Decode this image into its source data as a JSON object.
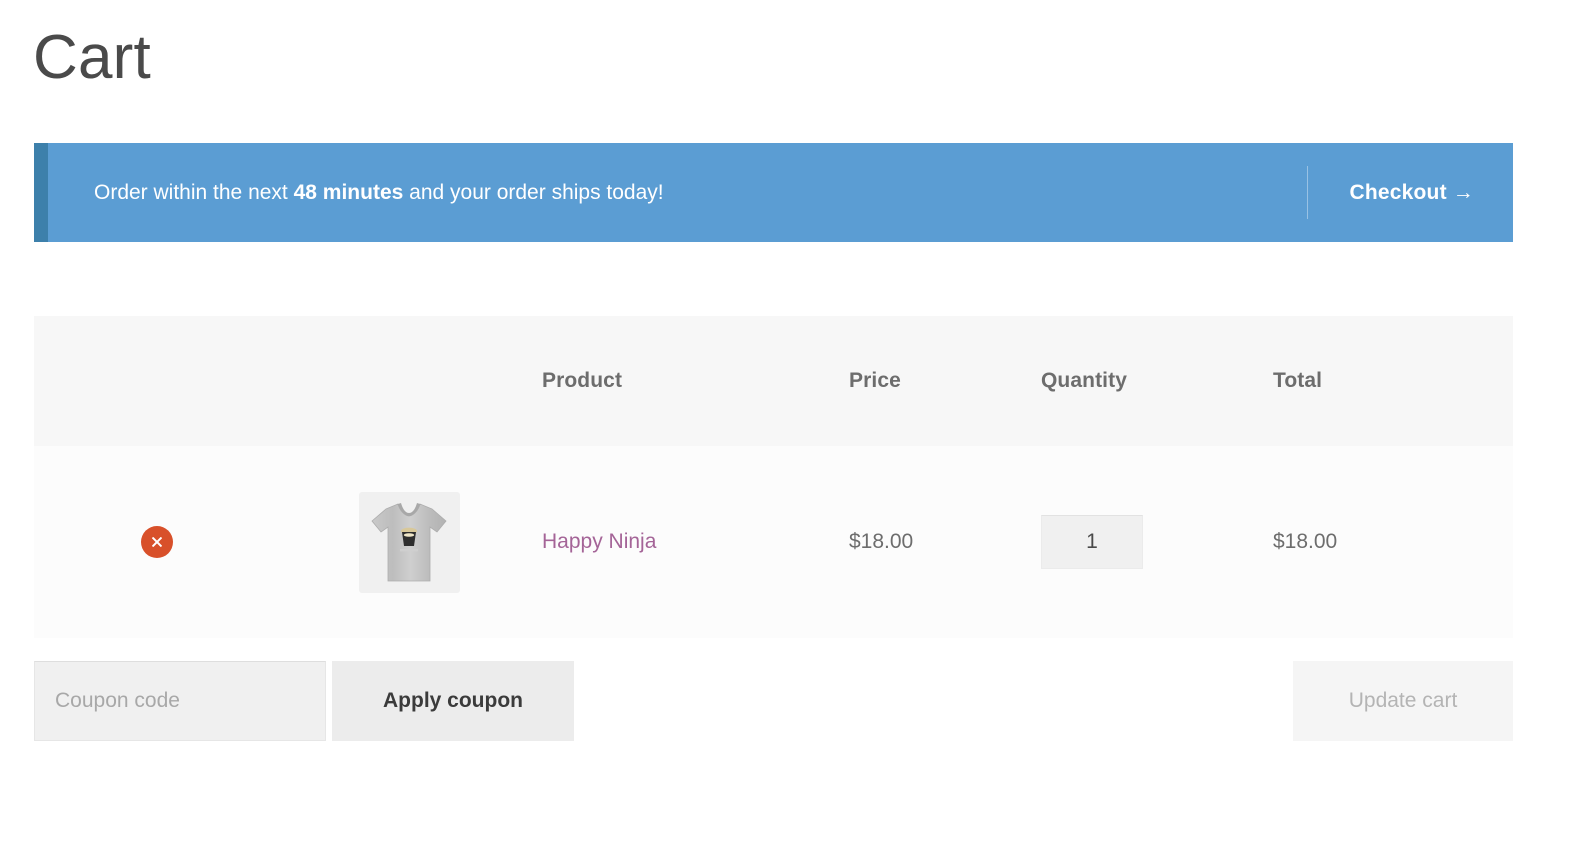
{
  "page": {
    "title": "Cart"
  },
  "banner": {
    "text_before": "Order within the next ",
    "highlight": "48 minutes",
    "text_after": " and your order ships today!",
    "checkout_label": "Checkout →",
    "background_color": "#5b9dd3",
    "accent_color": "#3d80ab"
  },
  "table": {
    "headers": {
      "remove": "",
      "thumbnail": "",
      "product": "Product",
      "price": "Price",
      "quantity": "Quantity",
      "total": "Total"
    },
    "rows": [
      {
        "remove_icon": "remove-circle-x-icon",
        "thumbnail_icon": "tshirt-product-image",
        "product": "Happy Ninja",
        "price": "$18.00",
        "quantity": "1",
        "total": "$18.00",
        "product_link_color": "#a46497"
      }
    ]
  },
  "actions": {
    "coupon_placeholder": "Coupon code",
    "coupon_value": "",
    "apply_label": "Apply coupon",
    "update_label": "Update cart"
  }
}
